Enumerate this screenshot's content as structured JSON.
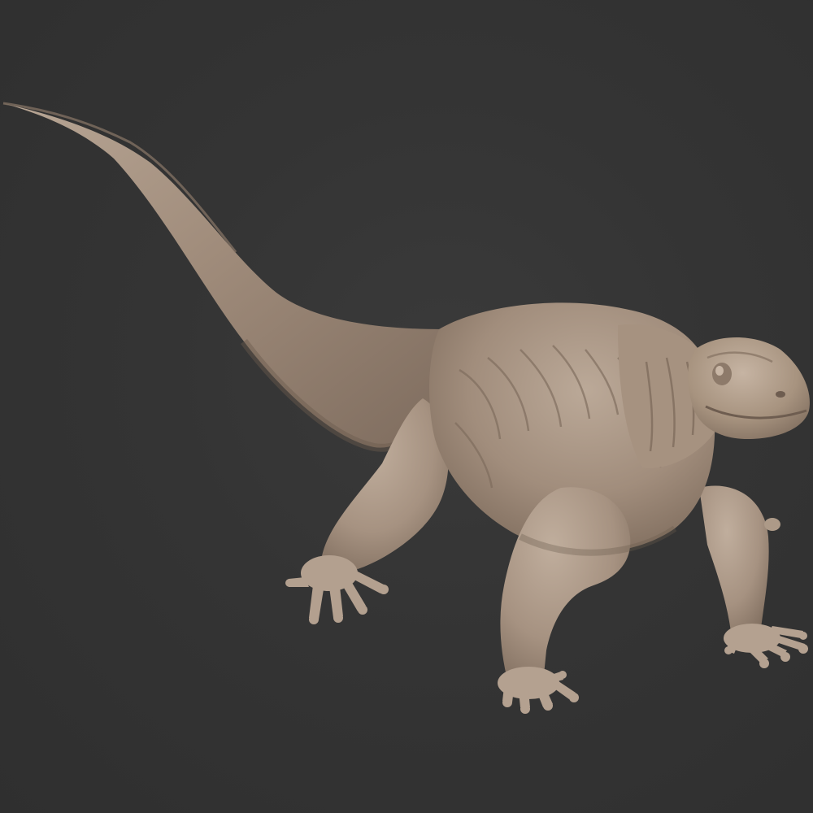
{
  "viewport": {
    "background_color": "#333333"
  },
  "model": {
    "subject": "monitor-lizard-sculpt",
    "material_color": "#9f8c7c",
    "highlight_color": "#c2b0a0",
    "shadow_color": "#6b5b4e"
  }
}
